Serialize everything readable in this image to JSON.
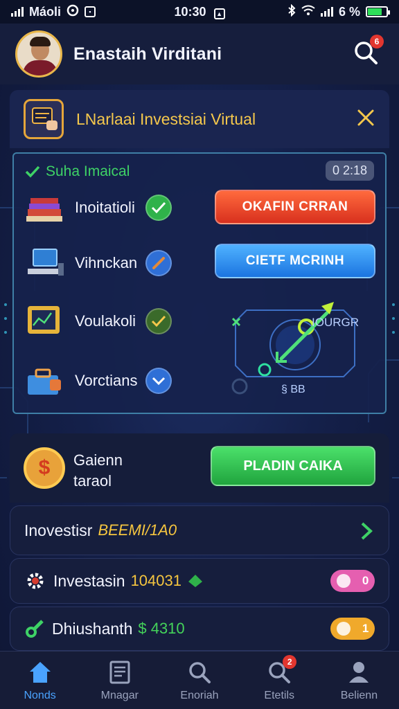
{
  "status_bar": {
    "carrier": "Máoli",
    "time": "10:30",
    "battery_text": "6 %",
    "battery_fraction": 0.75
  },
  "header": {
    "user_name": "Enastaih Virditani",
    "search_badge": "6"
  },
  "banner": {
    "title": "LNarlaai Investsiai Virtual"
  },
  "panel": {
    "status_text": "Suha Imaical",
    "counter": "0 2:18",
    "tasks": [
      {
        "label": "Inoitatioli",
        "icon": "books-icon",
        "check": "check-icon"
      },
      {
        "label": "Vihnckan",
        "icon": "computer-icon",
        "check": "pencil-icon"
      },
      {
        "label": "Voulakoli",
        "icon": "chart-monitor-icon",
        "check": "check-icon"
      },
      {
        "label": "Vorctians",
        "icon": "toolbox-icon",
        "check": "chevron-down-icon"
      }
    ],
    "primary_button": "OKAFIN CRRAN",
    "secondary_button": "CIETF MCRINH",
    "diagram_label": "IOURGR",
    "diagram_code": "§ BB"
  },
  "gains": {
    "title_line1": "Gaienn",
    "title_line2": "taraol",
    "coin_symbol": "$",
    "button": "PLADIN CAIKA"
  },
  "rows": [
    {
      "label": "Inovestisr",
      "value": "BEEMI/1A0"
    },
    {
      "label": "Investasin",
      "value": "104031",
      "pill": "0"
    },
    {
      "label": "Dhiushanth",
      "value": "$ 4310",
      "pill": "1"
    }
  ],
  "nav": [
    {
      "label": "Nonds",
      "icon": "home-icon"
    },
    {
      "label": "Mnagar",
      "icon": "news-icon"
    },
    {
      "label": "Enoriah",
      "icon": "search-icon"
    },
    {
      "label": "Etetils",
      "icon": "search-badge-icon",
      "badge": "2"
    },
    {
      "label": "Belienn",
      "icon": "profile-icon"
    }
  ],
  "colors": {
    "accent_green": "#3ed266",
    "accent_yellow": "#f5c84c",
    "active_nav": "#4aa3ff"
  }
}
